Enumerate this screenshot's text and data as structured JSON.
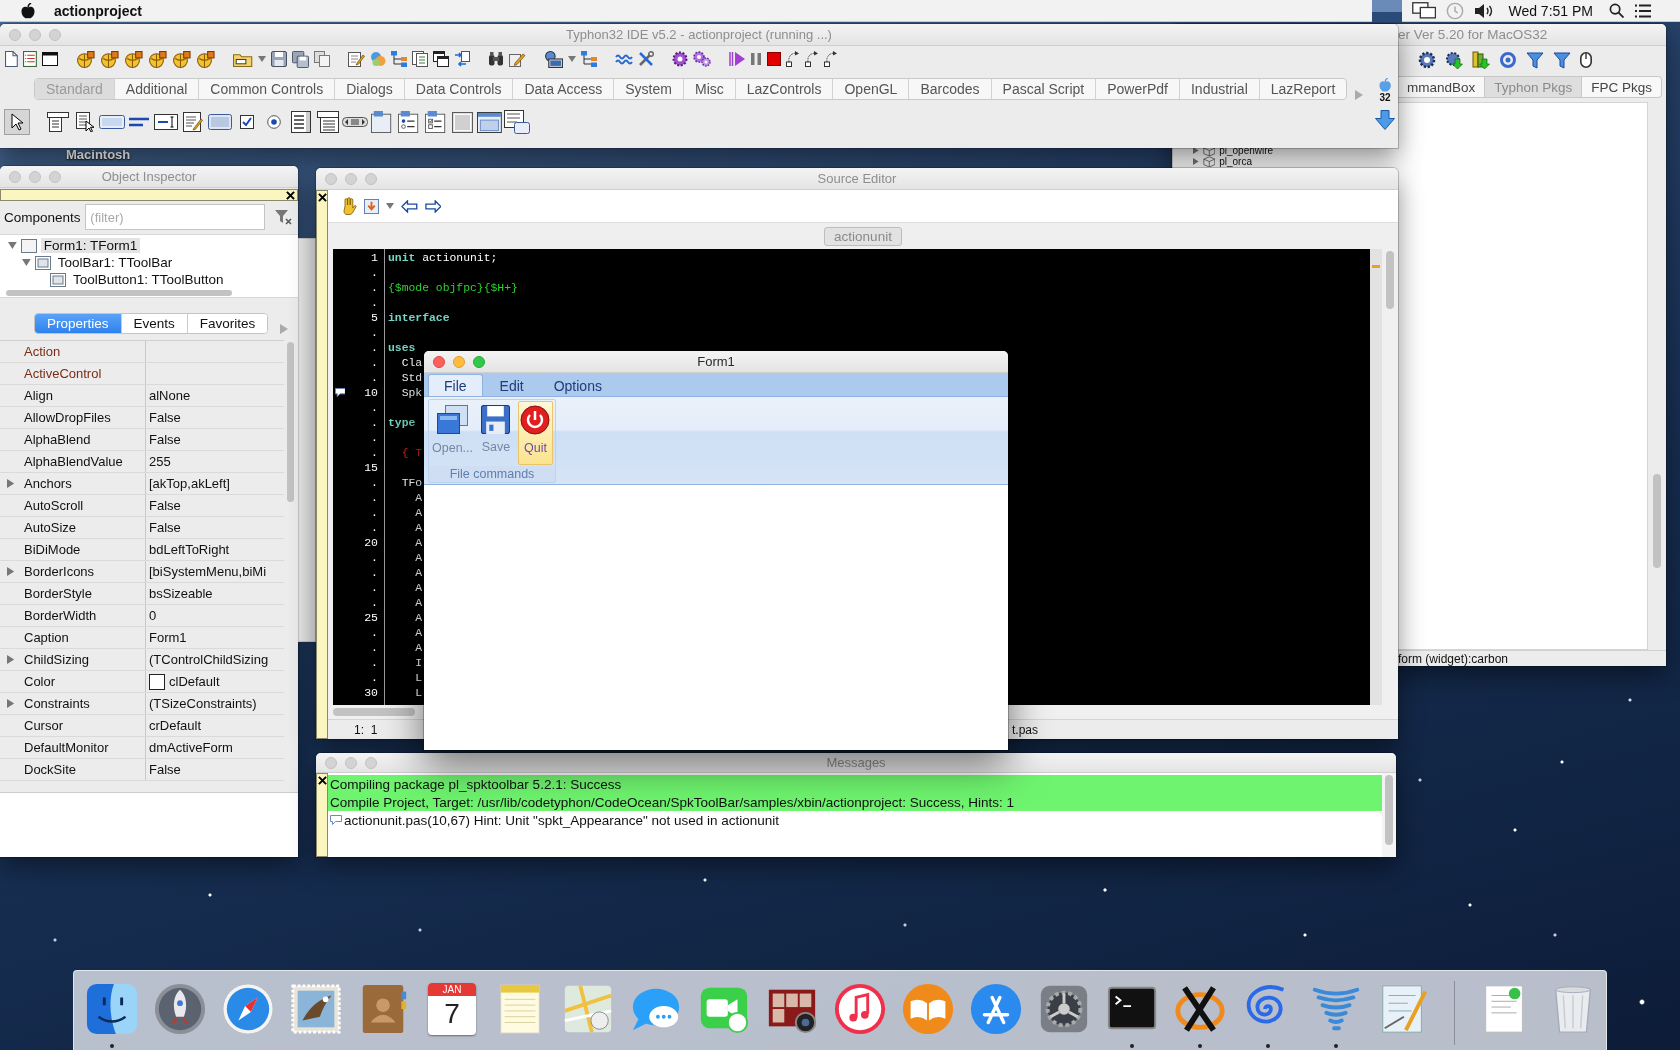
{
  "menu_bar": {
    "app_name": "actionproject",
    "clock": "Wed 7:51 PM"
  },
  "desktop": {
    "disk_label": "Macintosh"
  },
  "package_window": {
    "title": "er Ver 5.20 for MacOS32",
    "active": false,
    "tabs": [
      {
        "label": "mmandBox",
        "selected": false
      },
      {
        "label": "Typhon Pkgs",
        "selected": true
      },
      {
        "label": "FPC Pkgs",
        "selected": false
      }
    ],
    "packages": [
      {
        "label": "pl_openwire",
        "expanded": false
      },
      {
        "label": "pl_orca",
        "expanded": false
      }
    ],
    "status_bar": "form (widget):carbon"
  },
  "ide_window": {
    "title": "Typhon32 IDE v5.2 - actionproject (running ...)",
    "active": false,
    "palette_tabs": [
      {
        "label": "Standard",
        "selected": true
      },
      {
        "label": "Additional",
        "selected": false
      },
      {
        "label": "Common Controls",
        "selected": false
      },
      {
        "label": "Dialogs",
        "selected": false
      },
      {
        "label": "Data Controls",
        "selected": false
      },
      {
        "label": "Data Access",
        "selected": false
      },
      {
        "label": "System",
        "selected": false
      },
      {
        "label": "Misc",
        "selected": false
      },
      {
        "label": "LazControls",
        "selected": false
      },
      {
        "label": "OpenGL",
        "selected": false
      },
      {
        "label": "Barcodes",
        "selected": false
      },
      {
        "label": "Pascal Script",
        "selected": false
      },
      {
        "label": "PowerPdf",
        "selected": false
      },
      {
        "label": "Industrial",
        "selected": false
      },
      {
        "label": "LazReport",
        "selected": false
      }
    ],
    "pointer_tool": {
      "selected": true
    },
    "platform_badge": "32"
  },
  "object_inspector": {
    "title": "Object Inspector",
    "active": false,
    "components_label": "Components",
    "filter_placeholder": "(filter)",
    "tree": [
      {
        "label": "Form1: TForm1",
        "selected": true,
        "expanded": true,
        "children": [
          {
            "label": "ToolBar1: TToolBar",
            "selected": false,
            "expanded": true,
            "children": [
              {
                "label": "ToolButton1: TToolButton",
                "selected": false
              }
            ]
          }
        ]
      }
    ],
    "tabs": [
      {
        "label": "Properties",
        "selected": true
      },
      {
        "label": "Events",
        "selected": false
      },
      {
        "label": "Favorites",
        "selected": false
      }
    ],
    "properties": [
      {
        "name": "Action",
        "kind": "reference"
      },
      {
        "name": "ActiveControl",
        "kind": "reference"
      },
      {
        "name": "Align",
        "value": "alNone",
        "kind": "plain"
      },
      {
        "name": "AllowDropFiles",
        "value": "False",
        "kind": "plain"
      },
      {
        "name": "AlphaBlend",
        "value": "False",
        "kind": "plain"
      },
      {
        "name": "AlphaBlendValue",
        "value": "255",
        "kind": "plain"
      },
      {
        "name": "Anchors",
        "value": "[akTop,akLeft]",
        "kind": "plain",
        "expanded": false
      },
      {
        "name": "AutoScroll",
        "value": "False",
        "kind": "plain"
      },
      {
        "name": "AutoSize",
        "value": "False",
        "kind": "plain"
      },
      {
        "name": "BiDiMode",
        "value": "bdLeftToRight",
        "kind": "plain"
      },
      {
        "name": "BorderIcons",
        "value": "[biSystemMenu,biMi",
        "kind": "plain",
        "expanded": false
      },
      {
        "name": "BorderStyle",
        "value": "bsSizeable",
        "kind": "plain"
      },
      {
        "name": "BorderWidth",
        "value": "0",
        "kind": "plain"
      },
      {
        "name": "Caption",
        "value": "Form1",
        "kind": "plain"
      },
      {
        "name": "ChildSizing",
        "value": "(TControlChildSizing",
        "kind": "plain",
        "expanded": false
      },
      {
        "name": "Color",
        "value": "clDefault",
        "kind": "plain",
        "color": "#ffffff"
      },
      {
        "name": "Constraints",
        "value": "(TSizeConstraints)",
        "kind": "plain",
        "expanded": false
      },
      {
        "name": "Cursor",
        "value": "crDefault",
        "kind": "plain"
      },
      {
        "name": "DefaultMonitor",
        "value": "dmActiveForm",
        "kind": "plain"
      },
      {
        "name": "DockSite",
        "value": "False",
        "kind": "plain"
      }
    ]
  },
  "source_editor": {
    "title": "Source Editor",
    "active": false,
    "tabs": [
      {
        "label": "actionunit",
        "selected": true
      }
    ],
    "lines": [
      {
        "gutter": "1",
        "hint": false,
        "tokens": [
          {
            "kind": "keyword",
            "text": "unit"
          },
          {
            "kind": "plain",
            "text": " actionunit;"
          }
        ]
      },
      {
        "gutter": ".",
        "hint": false
      },
      {
        "gutter": ".",
        "hint": false,
        "tokens": [
          {
            "kind": "directive",
            "text": "{$mode objfpc}{$H+}"
          }
        ]
      },
      {
        "gutter": ".",
        "hint": false
      },
      {
        "gutter": "5",
        "hint": false,
        "tokens": [
          {
            "kind": "keyword",
            "text": "interface"
          }
        ]
      },
      {
        "gutter": ".",
        "hint": false
      },
      {
        "gutter": ".",
        "hint": false,
        "tokens": [
          {
            "kind": "keyword",
            "text": "uses"
          }
        ]
      },
      {
        "gutter": ".",
        "hint": false,
        "tokens": [
          {
            "kind": "plain",
            "text": "  Cla"
          }
        ]
      },
      {
        "gutter": ".",
        "hint": false,
        "tokens": [
          {
            "kind": "plain",
            "text": "  Std"
          }
        ]
      },
      {
        "gutter": "10",
        "hint": true,
        "tokens": [
          {
            "kind": "plain",
            "text": "  Spk"
          }
        ]
      },
      {
        "gutter": ".",
        "hint": false
      },
      {
        "gutter": ".",
        "hint": false,
        "tokens": [
          {
            "kind": "keyword",
            "text": "type"
          }
        ]
      },
      {
        "gutter": ".",
        "hint": false
      },
      {
        "gutter": ".",
        "hint": false,
        "tokens": [
          {
            "kind": "comment",
            "text": "  { T"
          }
        ]
      },
      {
        "gutter": "15",
        "hint": false
      },
      {
        "gutter": ".",
        "hint": false,
        "tokens": [
          {
            "kind": "plain",
            "text": "  TFo"
          }
        ]
      },
      {
        "gutter": ".",
        "hint": false,
        "tokens": [
          {
            "kind": "plain",
            "text": "    A"
          }
        ]
      },
      {
        "gutter": ".",
        "hint": false,
        "tokens": [
          {
            "kind": "plain",
            "text": "    A"
          }
        ]
      },
      {
        "gutter": ".",
        "hint": false,
        "tokens": [
          {
            "kind": "plain",
            "text": "    A"
          }
        ]
      },
      {
        "gutter": "20",
        "hint": false,
        "tokens": [
          {
            "kind": "plain",
            "text": "    A"
          }
        ]
      },
      {
        "gutter": ".",
        "hint": false,
        "tokens": [
          {
            "kind": "plain",
            "text": "    A"
          }
        ]
      },
      {
        "gutter": ".",
        "hint": false,
        "tokens": [
          {
            "kind": "plain",
            "text": "    A"
          }
        ]
      },
      {
        "gutter": ".",
        "hint": false,
        "tokens": [
          {
            "kind": "plain",
            "text": "    A"
          }
        ]
      },
      {
        "gutter": ".",
        "hint": false,
        "tokens": [
          {
            "kind": "plain",
            "text": "    A"
          }
        ]
      },
      {
        "gutter": "25",
        "hint": false,
        "tokens": [
          {
            "kind": "plain",
            "text": "    A"
          }
        ]
      },
      {
        "gutter": ".",
        "hint": false,
        "tokens": [
          {
            "kind": "plain",
            "text": "    A"
          }
        ]
      },
      {
        "gutter": ".",
        "hint": false,
        "tokens": [
          {
            "kind": "plain",
            "text": "    A"
          }
        ]
      },
      {
        "gutter": ".",
        "hint": false,
        "tokens": [
          {
            "kind": "plain",
            "text": "    I"
          }
        ]
      },
      {
        "gutter": ".",
        "hint": false,
        "tokens": [
          {
            "kind": "plain",
            "text": "    L"
          }
        ]
      },
      {
        "gutter": "30",
        "hint": false,
        "tokens": [
          {
            "kind": "plain",
            "text": "    L"
          }
        ]
      }
    ],
    "cursor_position": "1:  1",
    "file_name": "t.pas"
  },
  "messages": {
    "title": "Messages",
    "active": false,
    "lines": [
      {
        "kind": "success",
        "text": "Compiling package pl_spktoolbar 5.2.1: Success"
      },
      {
        "kind": "success",
        "text": "Compile Project, Target: /usr/lib/codetyphon/CodeOcean/SpkToolBar/samples/xbin/actionproject: Success, Hints: 1"
      },
      {
        "kind": "hint",
        "text": "actionunit.pas(10,67) Hint: Unit \"spkt_Appearance\" not used in actionunit"
      }
    ]
  },
  "form_window": {
    "title": "Form1",
    "active": true,
    "menu_tabs": [
      {
        "label": "File",
        "selected": true
      },
      {
        "label": "Edit",
        "selected": false
      },
      {
        "label": "Options",
        "selected": false
      }
    ],
    "groups": [
      {
        "caption": "File commands",
        "buttons": [
          {
            "label": "Open...",
            "highlighted": false
          },
          {
            "label": "Save",
            "highlighted": false
          },
          {
            "label": "Quit",
            "highlighted": true
          }
        ]
      }
    ]
  },
  "dock": {
    "items": [
      {
        "running": true
      },
      {
        "running": false
      },
      {
        "running": false
      },
      {
        "running": false
      },
      {
        "running": false
      },
      {
        "running": false,
        "month": "JAN",
        "day": "7"
      },
      {
        "running": false
      },
      {
        "running": false
      },
      {
        "running": false
      },
      {
        "running": false
      },
      {
        "running": false
      },
      {
        "running": false
      },
      {
        "running": false
      },
      {
        "running": false
      },
      {
        "running": false
      },
      {
        "running": true
      },
      {
        "running": true
      },
      {
        "running": true
      },
      {
        "running": true
      },
      {
        "running": false
      },
      {
        "running": false
      },
      {
        "running": false
      }
    ]
  }
}
